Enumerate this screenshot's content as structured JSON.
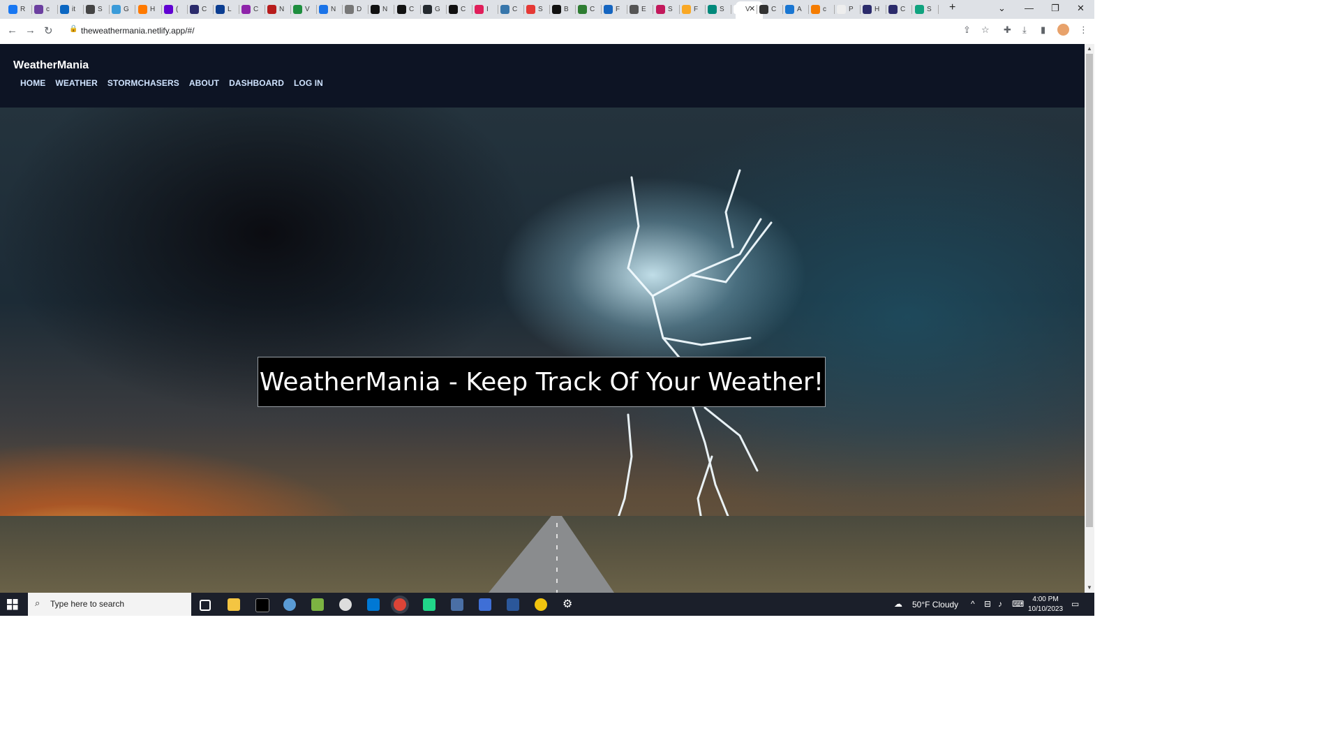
{
  "browser": {
    "tabs": [
      {
        "letter": "R",
        "color": "#1877f2"
      },
      {
        "letter": "c",
        "color": "#6b3fa0"
      },
      {
        "letter": "it",
        "color": "#0a66c2"
      },
      {
        "letter": "S",
        "color": "#444"
      },
      {
        "letter": "G",
        "color": "#3a9bd9"
      },
      {
        "letter": "H",
        "color": "#ff7a00"
      },
      {
        "letter": "(",
        "color": "#6001d2"
      },
      {
        "letter": "C",
        "color": "#2b2b6b"
      },
      {
        "letter": "L",
        "color": "#0b3d91"
      },
      {
        "letter": "C",
        "color": "#8e24aa"
      },
      {
        "letter": "N",
        "color": "#b71c1c"
      },
      {
        "letter": "V",
        "color": "#1e8e3e"
      },
      {
        "letter": "N",
        "color": "#1a73e8"
      },
      {
        "letter": "D",
        "color": "#777"
      },
      {
        "letter": "N",
        "color": "#111"
      },
      {
        "letter": "C",
        "color": "#111"
      },
      {
        "letter": "G",
        "color": "#24292e"
      },
      {
        "letter": "C",
        "color": "#111"
      },
      {
        "letter": "I",
        "color": "#e01e5a"
      },
      {
        "letter": "C",
        "color": "#3776ab"
      },
      {
        "letter": "S",
        "color": "#e53935"
      },
      {
        "letter": "B",
        "color": "#111"
      },
      {
        "letter": "C",
        "color": "#2e7d32"
      },
      {
        "letter": "F",
        "color": "#1565c0"
      },
      {
        "letter": "E",
        "color": "#555"
      },
      {
        "letter": "S",
        "color": "#c2185b"
      },
      {
        "letter": "F",
        "color": "#f9a825"
      },
      {
        "letter": "S",
        "color": "#00897b"
      },
      {
        "letter": "V",
        "color": "#fff"
      },
      {
        "letter": "C",
        "color": "#333"
      },
      {
        "letter": "A",
        "color": "#1976d2"
      },
      {
        "letter": "c",
        "color": "#f57c00"
      },
      {
        "letter": "P",
        "color": "#eee"
      },
      {
        "letter": "H",
        "color": "#2b2b6b"
      },
      {
        "letter": "C",
        "color": "#2b2b6b"
      },
      {
        "letter": "S",
        "color": "#10a37f"
      }
    ],
    "new_tab": "+",
    "url": "theweathermania.netlify.app/#/"
  },
  "site": {
    "brand": "WeatherMania",
    "nav": [
      "HOME",
      "WEATHER",
      "STORMCHASERS",
      "ABOUT",
      "DASHBOARD",
      "LOG IN"
    ],
    "headline": "WeatherMania - Keep Track Of Your Weather!"
  },
  "taskbar": {
    "search_placeholder": "Type here to search",
    "weather": "50°F  Cloudy",
    "time": "4:00 PM",
    "date": "10/10/2023"
  },
  "colors": {
    "navbar_bg": "#0d1424",
    "nav_link": "#cfe3ff",
    "headline_bg": "#000000"
  }
}
